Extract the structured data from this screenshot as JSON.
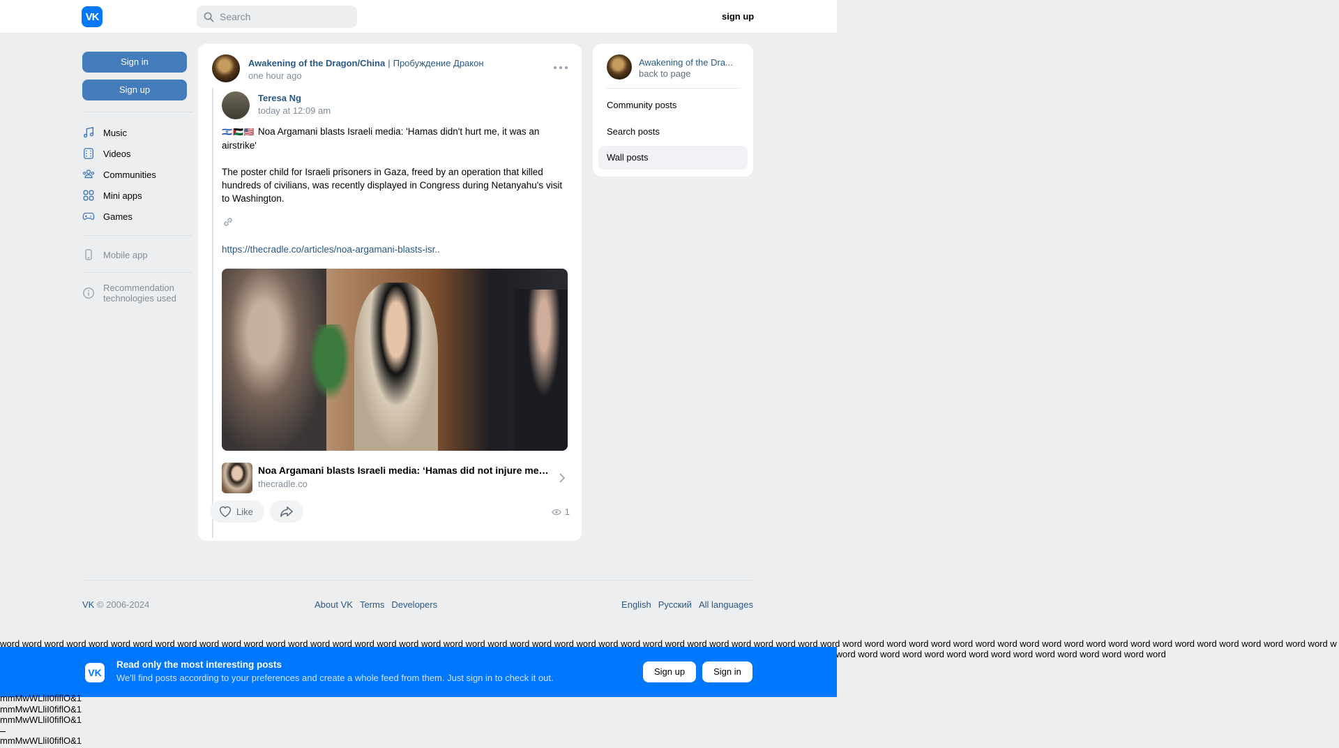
{
  "header": {
    "logo": "VK",
    "search_placeholder": "Search",
    "signup_label": "sign up"
  },
  "leftnav": {
    "signin_label": "Sign in",
    "signup_label": "Sign up",
    "items": [
      {
        "label": "Music",
        "icon": "music-icon"
      },
      {
        "label": "Videos",
        "icon": "video-icon"
      },
      {
        "label": "Communities",
        "icon": "communities-icon"
      },
      {
        "label": "Mini apps",
        "icon": "mini-apps-icon"
      },
      {
        "label": "Games",
        "icon": "gamepad-icon"
      }
    ],
    "mobile_app": "Mobile app",
    "recommendation": "Recommendation technologies used"
  },
  "post": {
    "author": "Awakening of the Dragon/China",
    "author_alt": "Пробуждение Дракон",
    "separator": "|",
    "time": "one hour ago",
    "repost": {
      "name": "Teresa Ng",
      "time": "today at 12:09 am",
      "flags": "🇮🇱🇵🇸🇺🇸",
      "headline": "Noa Argamani blasts Israeli media: 'Hamas didn't hurt me, it was an airstrike'",
      "body": "The poster child for Israeli prisoners in Gaza, freed by an operation that killed hundreds of civilians, was recently displayed in Congress during Netanyahu's visit to Washington.",
      "url": "https://thecradle.co/articles/noa-argamani-blasts-isr..",
      "card_title": "Noa Argamani blasts Israeli media: ‘Hamas did not injure me,…",
      "card_domain": "thecradle.co"
    },
    "like_label": "Like",
    "views": "1"
  },
  "rightpanel": {
    "title": "Awakening of the Dra...",
    "sub": "back to page",
    "links": [
      "Community posts",
      "Search posts",
      "Wall posts"
    ]
  },
  "footer": {
    "copyright": "VK",
    "years": "© 2006-2024",
    "links": [
      "About VK",
      "Terms",
      "Developers"
    ],
    "langs": [
      "English",
      "Русский",
      "All languages"
    ]
  },
  "wordstrip": "word word word word word word word word word word word word word word word word word word word word word word word word word word word word word word word word word word word word word word word word word word word word word word word word word word word word word word word word word word word word word word word word word word word word word word word word word word word word word word word word word word word word word word word word word word word word word word word word word word word word word word word word word word word word word word word word word",
  "banner": {
    "logo": "VK",
    "title": "Read only the most interesting posts",
    "subtitle": "We'll find posts according to your preferences and create a whole feed from them. Just sign in to check it out.",
    "signup": "Sign up",
    "signin": "Sign in"
  },
  "trash": [
    "mmMwWLliI0fiflO&1",
    "mmMwWLliI0fiflO&1",
    "mmMwWLliI0fiflO&1",
    "mmMwWLliI0fiflO&1"
  ],
  "colors": {
    "accent": "#0077ff",
    "link": "#2a5885",
    "button": "#447bba",
    "bg": "#edeef0"
  }
}
